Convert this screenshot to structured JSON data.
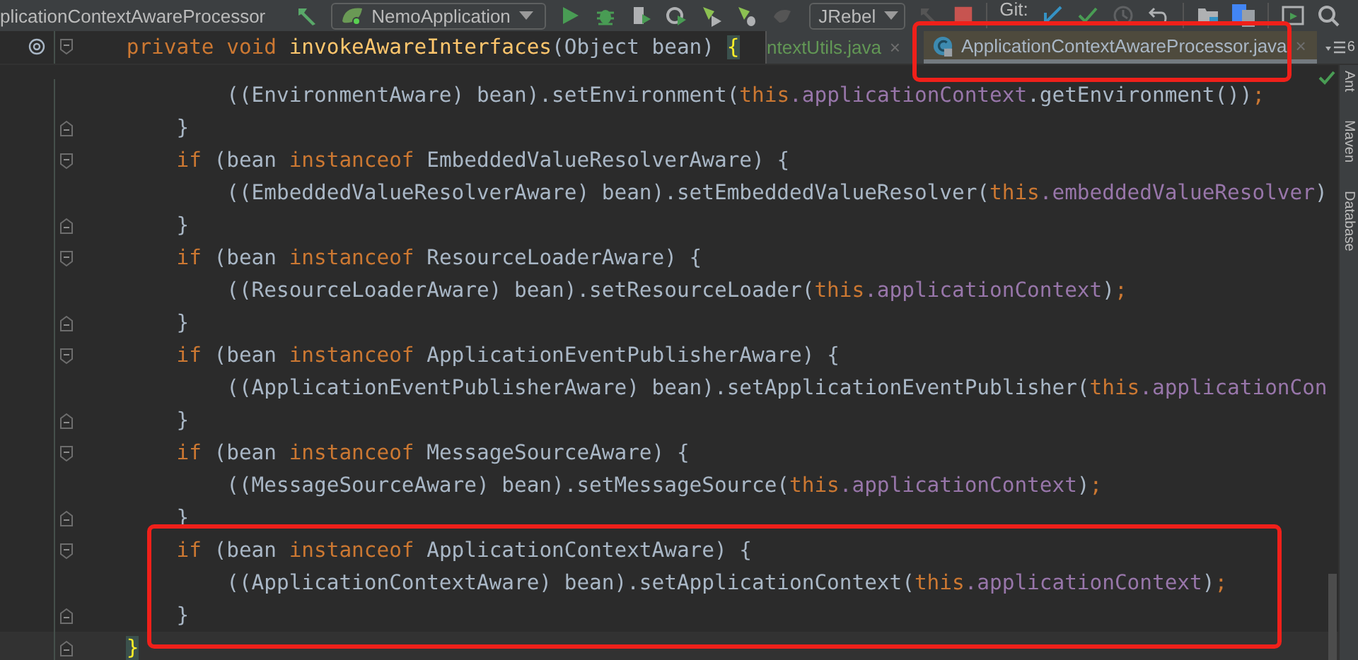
{
  "toolbar": {
    "file_title": "plicationContextAwareProcessor",
    "run_config": "NemoApplication",
    "jrebel_config": "JRebel",
    "git_label": "Git:"
  },
  "sticky_header": {
    "tokens": [
      {
        "kind": "keyword",
        "text": "private void "
      },
      {
        "kind": "decl",
        "text": "invokeAwareInterfaces"
      },
      {
        "kind": "plain",
        "text": "(Object bean) "
      },
      {
        "kind": "brace_match",
        "text": "{"
      }
    ]
  },
  "tabs": [
    {
      "label": "ntextUtils.java",
      "close": "×",
      "selected": false,
      "color": "#629755"
    },
    {
      "label": "ApplicationContextAwareProcessor.java",
      "close": "×",
      "selected": true,
      "color": "#a9b7c6"
    }
  ],
  "tab_overflow": {
    "count": "6"
  },
  "side_panels": [
    "Ant",
    "Maven",
    "Database"
  ],
  "code": {
    "lines": [
      {
        "children": [
          {
            "children": [
              {
                "tokens": [
                  {
                    "kind": "plain",
                    "text": "((EnvironmentAware) bean).setEnvironment("
                  },
                  {
                    "kind": "keyword",
                    "text": "this"
                  },
                  {
                    "kind": "field",
                    "text": ".applicationContext"
                  },
                  {
                    "kind": "plain",
                    "text": ".getEnvironment())"
                  },
                  {
                    "kind": "semicolon",
                    "text": ";"
                  }
                ]
              }
            ]
          },
          {
            "tokens": [
              {
                "kind": "plain",
                "text": "}"
              }
            ]
          },
          {
            "tokens": [
              {
                "kind": "keyword",
                "text": "if "
              },
              {
                "kind": "plain",
                "text": "(bean "
              },
              {
                "kind": "keyword",
                "text": "instanceof "
              },
              {
                "kind": "plain",
                "text": "EmbeddedValueResolverAware) {"
              }
            ],
            "children": [
              {
                "tokens": [
                  {
                    "kind": "plain",
                    "text": "((EmbeddedValueResolverAware) bean).setEmbeddedValueResolver("
                  },
                  {
                    "kind": "keyword",
                    "text": "this"
                  },
                  {
                    "kind": "field",
                    "text": ".embeddedValueResolver"
                  },
                  {
                    "kind": "plain",
                    "text": ")"
                  }
                ]
              }
            ]
          },
          {
            "tokens": [
              {
                "kind": "plain",
                "text": "}"
              }
            ]
          },
          {
            "tokens": [
              {
                "kind": "keyword",
                "text": "if "
              },
              {
                "kind": "plain",
                "text": "(bean "
              },
              {
                "kind": "keyword",
                "text": "instanceof "
              },
              {
                "kind": "plain",
                "text": "ResourceLoaderAware) {"
              }
            ],
            "children": [
              {
                "tokens": [
                  {
                    "kind": "plain",
                    "text": "((ResourceLoaderAware) bean).setResourceLoader("
                  },
                  {
                    "kind": "keyword",
                    "text": "this"
                  },
                  {
                    "kind": "field",
                    "text": ".applicationContext"
                  },
                  {
                    "kind": "plain",
                    "text": ")"
                  },
                  {
                    "kind": "semicolon",
                    "text": ";"
                  }
                ]
              }
            ]
          },
          {
            "tokens": [
              {
                "kind": "plain",
                "text": "}"
              }
            ]
          },
          {
            "tokens": [
              {
                "kind": "keyword",
                "text": "if "
              },
              {
                "kind": "plain",
                "text": "(bean "
              },
              {
                "kind": "keyword",
                "text": "instanceof "
              },
              {
                "kind": "plain",
                "text": "ApplicationEventPublisherAware) {"
              }
            ],
            "children": [
              {
                "tokens": [
                  {
                    "kind": "plain",
                    "text": "((ApplicationEventPublisherAware) bean).setApplicationEventPublisher("
                  },
                  {
                    "kind": "keyword",
                    "text": "this"
                  },
                  {
                    "kind": "field",
                    "text": ".applicationCon"
                  }
                ]
              }
            ]
          },
          {
            "tokens": [
              {
                "kind": "plain",
                "text": "}"
              }
            ]
          },
          {
            "tokens": [
              {
                "kind": "keyword",
                "text": "if "
              },
              {
                "kind": "plain",
                "text": "(bean "
              },
              {
                "kind": "keyword",
                "text": "instanceof "
              },
              {
                "kind": "plain",
                "text": "MessageSourceAware) {"
              }
            ],
            "children": [
              {
                "tokens": [
                  {
                    "kind": "plain",
                    "text": "((MessageSourceAware) bean).setMessageSource("
                  },
                  {
                    "kind": "keyword",
                    "text": "this"
                  },
                  {
                    "kind": "field",
                    "text": ".applicationContext"
                  },
                  {
                    "kind": "plain",
                    "text": ")"
                  },
                  {
                    "kind": "semicolon",
                    "text": ";"
                  }
                ]
              }
            ]
          },
          {
            "tokens": [
              {
                "kind": "plain",
                "text": "}"
              }
            ]
          },
          {
            "tokens": [
              {
                "kind": "keyword",
                "text": "if "
              },
              {
                "kind": "plain",
                "text": "(bean "
              },
              {
                "kind": "keyword",
                "text": "instanceof "
              },
              {
                "kind": "plain",
                "text": "ApplicationContextAware) {"
              }
            ],
            "children": [
              {
                "tokens": [
                  {
                    "kind": "plain",
                    "text": "((ApplicationContextAware) bean).setApplicationContext("
                  },
                  {
                    "kind": "keyword",
                    "text": "this"
                  },
                  {
                    "kind": "field",
                    "text": ".applicationContext"
                  },
                  {
                    "kind": "plain",
                    "text": ")"
                  },
                  {
                    "kind": "semicolon",
                    "text": ";"
                  }
                ]
              }
            ]
          },
          {
            "tokens": [
              {
                "kind": "plain",
                "text": "}"
              }
            ]
          }
        ]
      },
      {
        "tokens": [
          {
            "kind": "brace_match",
            "text": "}"
          }
        ],
        "current": true
      }
    ]
  }
}
